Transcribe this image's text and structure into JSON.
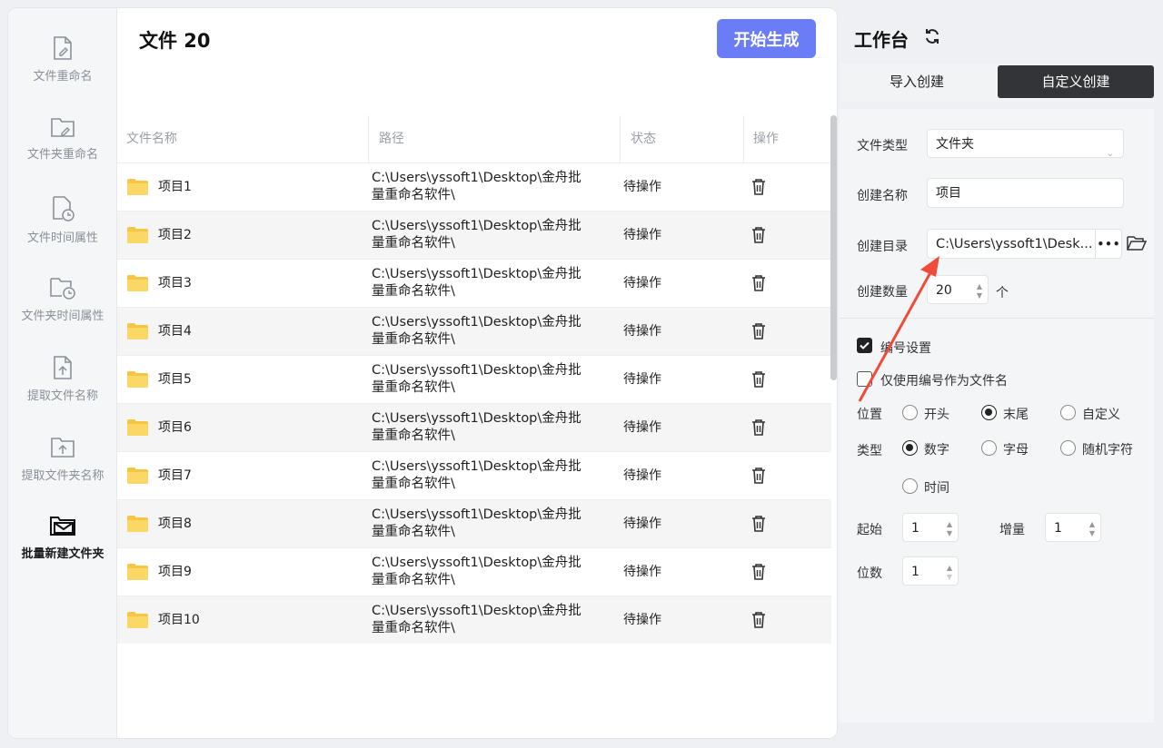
{
  "sidebar": {
    "items": [
      {
        "label": "文件重命名",
        "icon": "file-edit-icon",
        "active": false
      },
      {
        "label": "文件夹重命名",
        "icon": "folder-edit-icon",
        "active": false
      },
      {
        "label": "文件时间属性",
        "icon": "file-clock-icon",
        "active": false
      },
      {
        "label": "文件夹时间属性",
        "icon": "folder-clock-icon",
        "active": false
      },
      {
        "label": "提取文件名称",
        "icon": "file-upload-icon",
        "active": false
      },
      {
        "label": "提取文件夹名称",
        "icon": "folder-upload-icon",
        "active": false
      },
      {
        "label": "批量新建文件夹",
        "icon": "mail-folder-icon",
        "active": true
      }
    ]
  },
  "header": {
    "title": "文件 20",
    "start_label": "开始生成"
  },
  "table": {
    "columns": [
      "文件名称",
      "路径",
      "状态",
      "操作"
    ],
    "rows": [
      {
        "name": "项目1",
        "path_line1": "C:\\Users\\yssoft1\\Desktop\\金舟批",
        "path_line2": "量重命名软件\\",
        "status": "待操作"
      },
      {
        "name": "项目2",
        "path_line1": "C:\\Users\\yssoft1\\Desktop\\金舟批",
        "path_line2": "量重命名软件\\",
        "status": "待操作"
      },
      {
        "name": "项目3",
        "path_line1": "C:\\Users\\yssoft1\\Desktop\\金舟批",
        "path_line2": "量重命名软件\\",
        "status": "待操作"
      },
      {
        "name": "项目4",
        "path_line1": "C:\\Users\\yssoft1\\Desktop\\金舟批",
        "path_line2": "量重命名软件\\",
        "status": "待操作"
      },
      {
        "name": "项目5",
        "path_line1": "C:\\Users\\yssoft1\\Desktop\\金舟批",
        "path_line2": "量重命名软件\\",
        "status": "待操作"
      },
      {
        "name": "项目6",
        "path_line1": "C:\\Users\\yssoft1\\Desktop\\金舟批",
        "path_line2": "量重命名软件\\",
        "status": "待操作"
      },
      {
        "name": "项目7",
        "path_line1": "C:\\Users\\yssoft1\\Desktop\\金舟批",
        "path_line2": "量重命名软件\\",
        "status": "待操作"
      },
      {
        "name": "项目8",
        "path_line1": "C:\\Users\\yssoft1\\Desktop\\金舟批",
        "path_line2": "量重命名软件\\",
        "status": "待操作"
      },
      {
        "name": "项目9",
        "path_line1": "C:\\Users\\yssoft1\\Desktop\\金舟批",
        "path_line2": "量重命名软件\\",
        "status": "待操作"
      },
      {
        "name": "项目10",
        "path_line1": "C:\\Users\\yssoft1\\Desktop\\金舟批",
        "path_line2": "量重命名软件\\",
        "status": "待操作"
      }
    ]
  },
  "panel": {
    "title": "工作台",
    "tabs": [
      "导入创建",
      "自定义创建"
    ],
    "active_tab": 1,
    "file_type_label": "文件类型",
    "file_type_value": "文件夹",
    "create_name_label": "创建名称",
    "create_name_value": "项目",
    "create_dir_label": "创建目录",
    "create_dir_value": "C:\\Users\\yssoft1\\Desk...",
    "create_dir_more": "•••",
    "create_count_label": "创建数量",
    "create_count_value": "20",
    "create_count_unit": "个",
    "numbering_label": "编号设置",
    "numbering_checked": true,
    "only_number_label": "仅使用编号作为文件名",
    "only_number_checked": false,
    "position_label": "位置",
    "position_options": [
      "开头",
      "末尾",
      "自定义"
    ],
    "position_selected": "末尾",
    "type_label": "类型",
    "type_options": [
      "数字",
      "字母",
      "随机字符",
      "时间"
    ],
    "type_selected": "数字",
    "start_label": "起始",
    "start_value": "1",
    "increment_label": "增量",
    "increment_value": "1",
    "digits_label": "位数",
    "digits_value": "1"
  },
  "colors": {
    "accent": "#6b7cf7",
    "active_tab": "#333437",
    "folder": "#f6c544",
    "annotation_arrow": "#f04a3a"
  }
}
